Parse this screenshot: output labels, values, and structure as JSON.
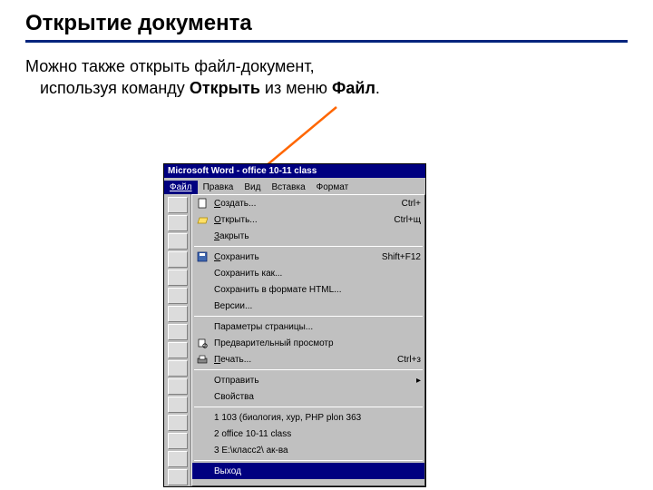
{
  "title": "Открытие документа",
  "body": {
    "line1": "Можно также открыть файл-документ,",
    "line2a": "используя команду ",
    "line2b_bold": "Открыть",
    "line2c": " из меню ",
    "line2d_bold": "Файл",
    "line2e": "."
  },
  "win": {
    "title": "Microsoft Word - office 10-11 class",
    "menus": [
      "Файл",
      "Правка",
      "Вид",
      "Вставка",
      "Формат"
    ],
    "file_menu": [
      {
        "u": "С",
        "rest": "оздать...",
        "shortcut": "Ctrl+"
      },
      {
        "u": "О",
        "rest": "ткрыть...",
        "shortcut": "Ctrl+щ"
      },
      {
        "u": "З",
        "rest": "акрыть"
      },
      {
        "u": "С",
        "rest": "охранить",
        "shortcut": "Shift+F12"
      },
      {
        "label": "Сохранить как..."
      },
      {
        "label": "Сохранить в формате HTML..."
      },
      {
        "label": "Версии..."
      },
      {
        "label": "Параметры страницы..."
      },
      {
        "label": "Предварительный просмотр"
      },
      {
        "u": "П",
        "rest": "ечать...",
        "shortcut": "Ctrl+з"
      },
      {
        "label": "Отправить",
        "arrow": "▸"
      },
      {
        "label": "Свойства"
      },
      {
        "label": "1 103 (биология, хур, РНР plon 363"
      },
      {
        "label": "2 office 10-11 class"
      },
      {
        "label": "3 E:\\класс2\\ ак-ва"
      },
      {
        "label": "Выход"
      }
    ]
  }
}
